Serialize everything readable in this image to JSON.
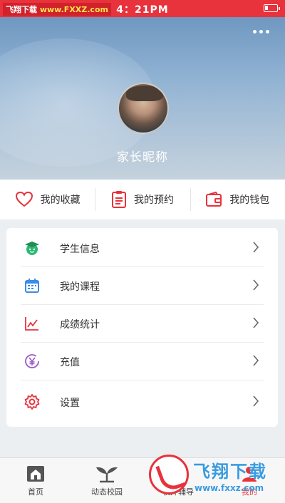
{
  "status_bar": {
    "watermark_a": "飞翔下载",
    "watermark_b": "www.FXXZ.com",
    "time": "4：21PM"
  },
  "profile": {
    "nickname": "家长昵称",
    "avatar_icon": "avatar-photo"
  },
  "quick_links": [
    {
      "label": "我的收藏",
      "icon": "heart-icon",
      "color": "#e8323c"
    },
    {
      "label": "我的预约",
      "icon": "clipboard-icon",
      "color": "#e8323c"
    },
    {
      "label": "我的钱包",
      "icon": "wallet-icon",
      "color": "#e8323c"
    }
  ],
  "menu": [
    {
      "label": "学生信息",
      "icon": "graduation-cap-icon",
      "color": "#2eb872"
    },
    {
      "label": "我的课程",
      "icon": "calendar-icon",
      "color": "#3b8be8"
    },
    {
      "label": "成绩统计",
      "icon": "chart-line-icon",
      "color": "#e8323c"
    },
    {
      "label": "充值",
      "icon": "yuan-coin-icon",
      "color": "#9b59c7"
    },
    {
      "label": "设置",
      "icon": "gear-icon",
      "color": "#e8323c"
    }
  ],
  "bottom_nav": [
    {
      "label": "首页",
      "icon": "home-icon"
    },
    {
      "label": "动态校园",
      "icon": "sprout-icon"
    },
    {
      "label": "校外辅导",
      "icon": "tutor-icon"
    },
    {
      "label": "我的",
      "icon": "profile-icon",
      "active": true
    }
  ],
  "watermark": {
    "title": "飞翔下载",
    "url": "www.fxxz.com"
  }
}
